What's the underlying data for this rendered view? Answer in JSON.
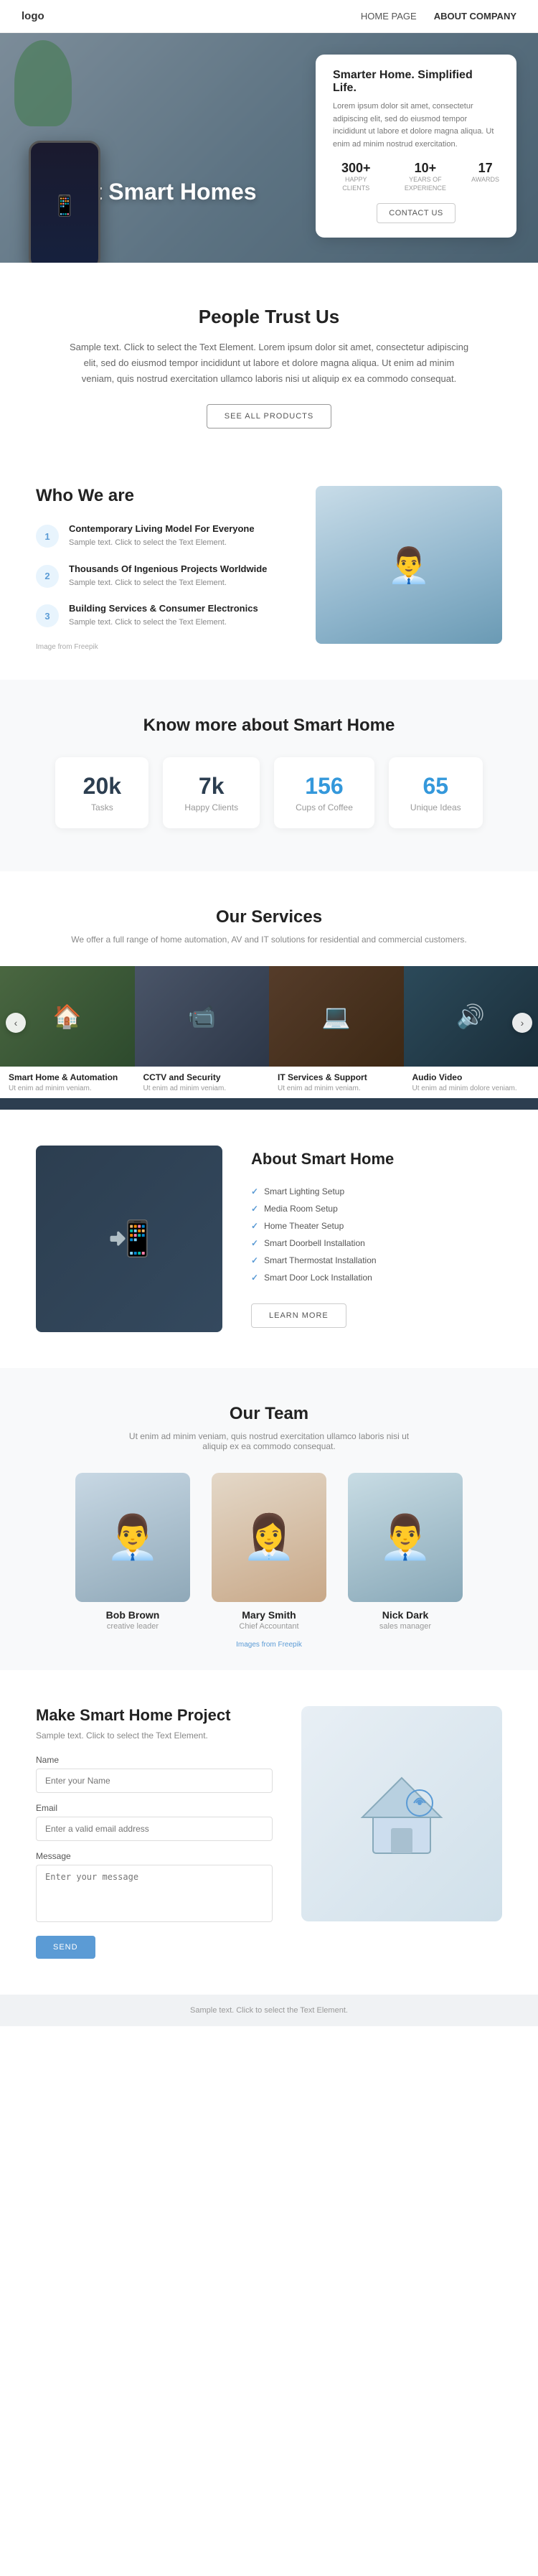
{
  "nav": {
    "logo": "logo",
    "links": [
      {
        "label": "HOME PAGE",
        "active": false
      },
      {
        "label": "ABOUT COMPANY",
        "active": true
      }
    ]
  },
  "hero": {
    "title": "About Smart Homes",
    "card": {
      "heading": "Smarter Home. Simplified Life.",
      "body": "Lorem ipsum dolor sit amet, consectetur adipiscing elit, sed do eiusmod tempor incididunt ut labore et dolore magna aliqua. Ut enim ad minim nostrud exercitation.",
      "stats": [
        {
          "num": "300+",
          "label": "HAPPY CLIENTS"
        },
        {
          "num": "10+",
          "label": "YEARS OF EXPERIENCE"
        },
        {
          "num": "17",
          "label": "AWARDS"
        }
      ],
      "button": "CONTACT US"
    }
  },
  "trust": {
    "heading": "People Trust Us",
    "body": "Sample text. Click to select the Text Element. Lorem ipsum dolor sit amet, consectetur adipiscing elit, sed do eiusmod tempor incididunt ut labore et dolore magna aliqua. Ut enim ad minim veniam, quis nostrud exercitation ullamco laboris nisi ut aliquip ex ea commodo consequat.",
    "button": "SEE ALL PRODUCTS"
  },
  "who": {
    "heading": "Who We are",
    "items": [
      {
        "num": "1",
        "title": "Contemporary Living Model For Everyone",
        "text": "Sample text. Click to select the Text Element."
      },
      {
        "num": "2",
        "title": "Thousands Of Ingenious Projects Worldwide",
        "text": "Sample text. Click to select the Text Element."
      },
      {
        "num": "3",
        "title": "Building Services & Consumer Electronics",
        "text": "Sample text. Click to select the Text Element."
      }
    ],
    "image_credit": "Image from Freepik",
    "freepik_url": "#"
  },
  "know": {
    "heading": "Know more about Smart Home",
    "stats": [
      {
        "num": "20k",
        "label": "Tasks",
        "color": "normal"
      },
      {
        "num": "7k",
        "label": "Happy Clients",
        "color": "normal"
      },
      {
        "num": "156",
        "label": "Cups of Coffee",
        "color": "blue"
      },
      {
        "num": "65",
        "label": "Unique Ideas",
        "color": "blue"
      }
    ]
  },
  "services": {
    "heading": "Our Services",
    "subheading": "We offer a full range of home automation, AV and IT solutions for residential and commercial customers.",
    "items": [
      {
        "icon": "🏠",
        "title": "Smart Home & Automation",
        "desc": "Ut enim ad minim veniam."
      },
      {
        "icon": "📹",
        "title": "CCTV and Security",
        "desc": "Ut enim ad minim veniam."
      },
      {
        "icon": "💻",
        "title": "IT Services & Support",
        "desc": "Ut enim ad minim veniam."
      },
      {
        "icon": "🔊",
        "title": "Audio Video",
        "desc": "Ut enim ad minim dolore veniam."
      }
    ]
  },
  "about_home": {
    "heading": "About Smart Home",
    "list": [
      "Smart Lighting Setup",
      "Media Room Setup",
      "Home Theater Setup",
      "Smart Doorbell Installation",
      "Smart Thermostat Installation",
      "Smart Door Lock Installation"
    ],
    "button": "LEARN MORE"
  },
  "team": {
    "heading": "Our Team",
    "subheading": "Ut enim ad minim veniam, quis nostrud exercitation ullamco laboris nisi ut aliquip ex ea commodo consequat.",
    "members": [
      {
        "name": "Bob Brown",
        "role": "creative leader",
        "avatar": "👨"
      },
      {
        "name": "Mary Smith",
        "role": "Chief Accountant",
        "avatar": "👩"
      },
      {
        "name": "Nick Dark",
        "role": "sales manager",
        "avatar": "👨"
      }
    ],
    "image_credit": "Images from Freepik",
    "freepik_url": "#"
  },
  "contact": {
    "heading": "Make Smart Home Project",
    "subheading": "Sample text. Click to select the Text Element.",
    "fields": [
      {
        "label": "Name",
        "placeholder": "Enter your Name",
        "type": "text"
      },
      {
        "label": "Email",
        "placeholder": "Enter a valid email address",
        "type": "email"
      },
      {
        "label": "Message",
        "placeholder": "Enter your message",
        "type": "textarea"
      }
    ],
    "button": "SEND"
  },
  "footer": {
    "text": "Sample text. Click to select the Text Element."
  }
}
